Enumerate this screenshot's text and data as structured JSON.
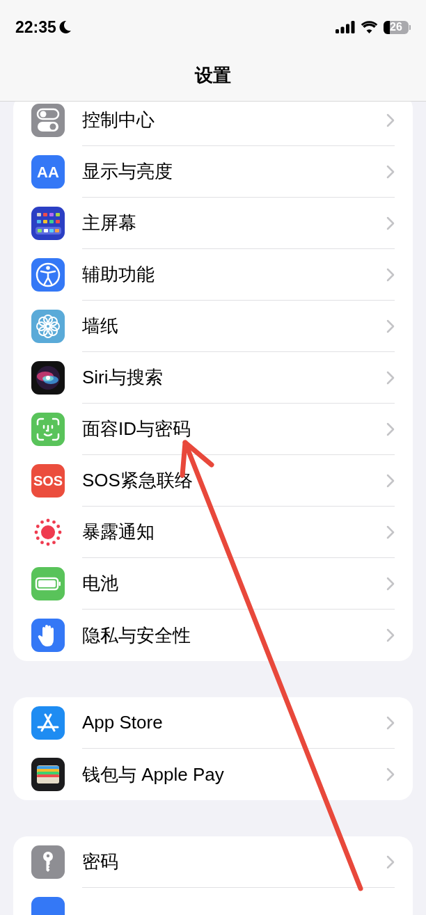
{
  "status_bar": {
    "time": "22:35",
    "battery": "26"
  },
  "nav": {
    "title": "设置"
  },
  "groups": [
    {
      "items": [
        {
          "label": "控制中心"
        },
        {
          "label": "显示与亮度",
          "icon_text": "AA"
        },
        {
          "label": "主屏幕"
        },
        {
          "label": "辅助功能"
        },
        {
          "label": "墙纸"
        },
        {
          "label": "Siri与搜索"
        },
        {
          "label": "面容ID与密码"
        },
        {
          "label": "SOS紧急联络",
          "icon_text": "SOS"
        },
        {
          "label": "暴露通知"
        },
        {
          "label": "电池"
        },
        {
          "label": "隐私与安全性"
        }
      ]
    },
    {
      "items": [
        {
          "label": "App Store"
        },
        {
          "label": "钱包与 Apple Pay"
        }
      ]
    },
    {
      "items": [
        {
          "label": "密码"
        }
      ]
    }
  ]
}
